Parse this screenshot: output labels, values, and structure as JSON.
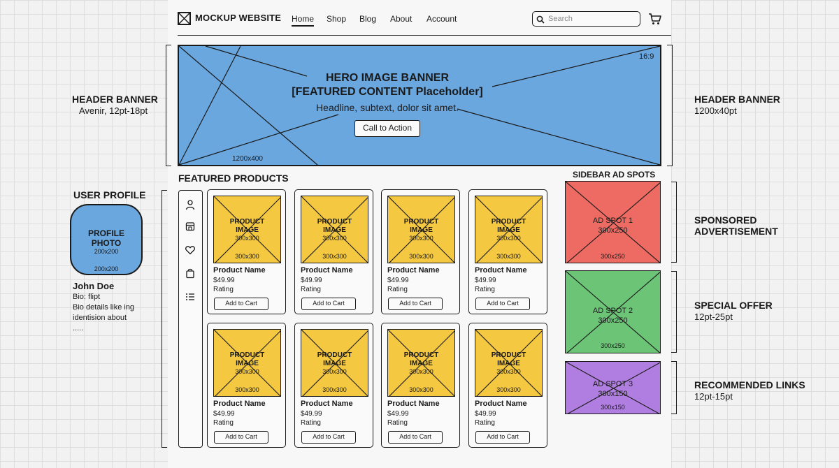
{
  "colors": {
    "hero": "#6aa7df",
    "product_image": "#f5c842",
    "ad_spot_1": "#ee6b63",
    "ad_spot_2": "#6cc477",
    "ad_spot_3": "#b07ee0"
  },
  "header": {
    "logo_icon": "crossed-box-logo-icon",
    "logo_text": "MOCKUP WEBSITE",
    "nav": {
      "home": "Home",
      "shop": "Shop",
      "blog": "Blog",
      "about": "About",
      "account": "Account"
    },
    "search_placeholder": "Search",
    "search_icon": "search-icon",
    "cart_icon": "cart-icon"
  },
  "hero": {
    "title": "HERO IMAGE BANNER",
    "subtitle": "[FEATURED CONTENT Placeholder]",
    "headline": "Headline, subtext, dolor sit amet.",
    "cta": "Call to Action",
    "ratio": "16:9",
    "size": "1200x400"
  },
  "annotations": {
    "header_banner_left": {
      "title": "HEADER BANNER",
      "sub": "Avenir, 12pt-18pt"
    },
    "header_banner_right": {
      "title": "HEADER BANNER",
      "sub": "1200x40pt"
    },
    "user_profile": "USER PROFILE",
    "sponsored": {
      "line1": "SPONSORED",
      "line2": "ADVERTISEMENT"
    },
    "special_offer": {
      "title": "SPECIAL OFFER",
      "sub": "12pt-25pt"
    },
    "recommended": {
      "title": "RECOMMENDED LINKS",
      "sub": "12pt-15pt"
    }
  },
  "profile": {
    "photo_line1": "PROFILE",
    "photo_line2": "PHOTO",
    "photo_dim_a": "200x200",
    "photo_dim_b": "200x200",
    "name": "John Doe",
    "bio": [
      "Bio: flipt",
      "Bio details like ing",
      "identision about",
      "....."
    ]
  },
  "sidebar_icons": [
    "user-icon",
    "store-icon",
    "heart-icon",
    "bag-icon",
    "list-icon"
  ],
  "featured": {
    "title": "FEATURED PRODUCTS",
    "products": [
      {
        "image_label_1": "PRODUCT",
        "image_label_2": "IMAGE",
        "image_dim": "300x300",
        "image_dim_2": "300x300",
        "name": "Product Name",
        "price": "$49.99",
        "rating": "Rating",
        "button": "Add to Cart"
      },
      {
        "image_label_1": "PRODUCT",
        "image_label_2": "IMAGE",
        "image_dim": "300x300",
        "image_dim_2": "300x300",
        "name": "Product Name",
        "price": "$49.99",
        "rating": "Rating",
        "button": "Add to Cart"
      },
      {
        "image_label_1": "PRODUCT",
        "image_label_2": "IMAGE",
        "image_dim": "300x300",
        "image_dim_2": "300x300",
        "name": "Product Name",
        "price": "$49.99",
        "rating": "Rating",
        "button": "Add to Cart"
      },
      {
        "image_label_1": "PRODUCT",
        "image_label_2": "IMAGE",
        "image_dim": "300x300",
        "image_dim_2": "300x300",
        "name": "Product Name",
        "price": "$49.99",
        "rating": "Rating",
        "button": "Add to Cart"
      },
      {
        "image_label_1": "PRODUCT",
        "image_label_2": "IMAGE",
        "image_dim": "300x300",
        "image_dim_2": "300x300",
        "name": "Product Name",
        "price": "$49.99",
        "rating": "Rating",
        "button": "Add to Cart"
      },
      {
        "image_label_1": "PRODUCT",
        "image_label_2": "IMAGE",
        "image_dim": "300x300",
        "image_dim_2": "300x300",
        "name": "Product Name",
        "price": "$49.99",
        "rating": "Rating",
        "button": "Add to Cart"
      },
      {
        "image_label_1": "PRODUCT",
        "image_label_2": "IMAGE",
        "image_dim": "300x300",
        "image_dim_2": "300x300",
        "name": "Product Name",
        "price": "$49.99",
        "rating": "Rating",
        "button": "Add to Cart"
      },
      {
        "image_label_1": "PRODUCT",
        "image_label_2": "IMAGE",
        "image_dim": "300x300",
        "image_dim_2": "300x300",
        "name": "Product Name",
        "price": "$49.99",
        "rating": "Rating",
        "button": "Add to Cart"
      }
    ]
  },
  "ads": {
    "title": "SIDEBAR AD SPOTS",
    "spots": [
      {
        "title": "AD SPOT 1",
        "size": "300x250",
        "dim": "300x250"
      },
      {
        "title": "AD SPOT 2",
        "size": "300x250",
        "dim": "300x250"
      },
      {
        "title": "AD SPOT 3",
        "size": "300x150",
        "dim": "300x150"
      }
    ]
  }
}
